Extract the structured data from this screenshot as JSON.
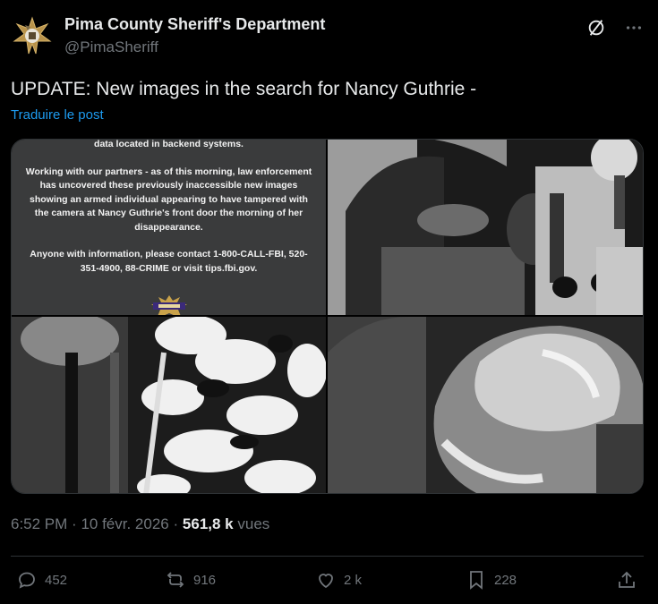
{
  "author": {
    "display_name": "Pima County Sheriff's Department",
    "handle": "@PimaSheriff",
    "avatar_icon": "sheriff-star-badge-icon"
  },
  "tweet": {
    "text": "UPDATE: New images in the search for Nancy Guthrie -",
    "translate_label": "Traduire le post"
  },
  "media": {
    "notice_line_1": "data located in backend systems.",
    "notice_paragraph_2": "Working with our partners - as of this morning, law enforcement has uncovered these previously inaccessible new images showing an armed individual appearing to have tampered with the camera at Nancy Guthrie's front door the morning of her disappearance.",
    "notice_paragraph_3": "Anyone with information, please contact 1-800-CALL-FBI, 520-351-4900, 88-CRIME or visit tips.fbi.gov.",
    "badge_icon": "sheriff-logo-icon",
    "photos": [
      "doorbell-camera-masked-person",
      "doorbell-camera-closeup-torso",
      "doorbell-camera-obstructed-by-plants",
      "doorbell-camera-glove-covering-lens"
    ]
  },
  "meta": {
    "time": "6:52 PM",
    "separator": "·",
    "date": "10 févr. 2026",
    "views_count": "561,8 k",
    "views_label": "vues"
  },
  "actions": {
    "replies": "452",
    "reposts": "916",
    "likes": "2 k",
    "bookmarks": "228"
  },
  "colors": {
    "background": "#000000",
    "text": "#e7e9ea",
    "muted": "#71767b",
    "link": "#1d9bf0",
    "border": "#2f3336"
  }
}
